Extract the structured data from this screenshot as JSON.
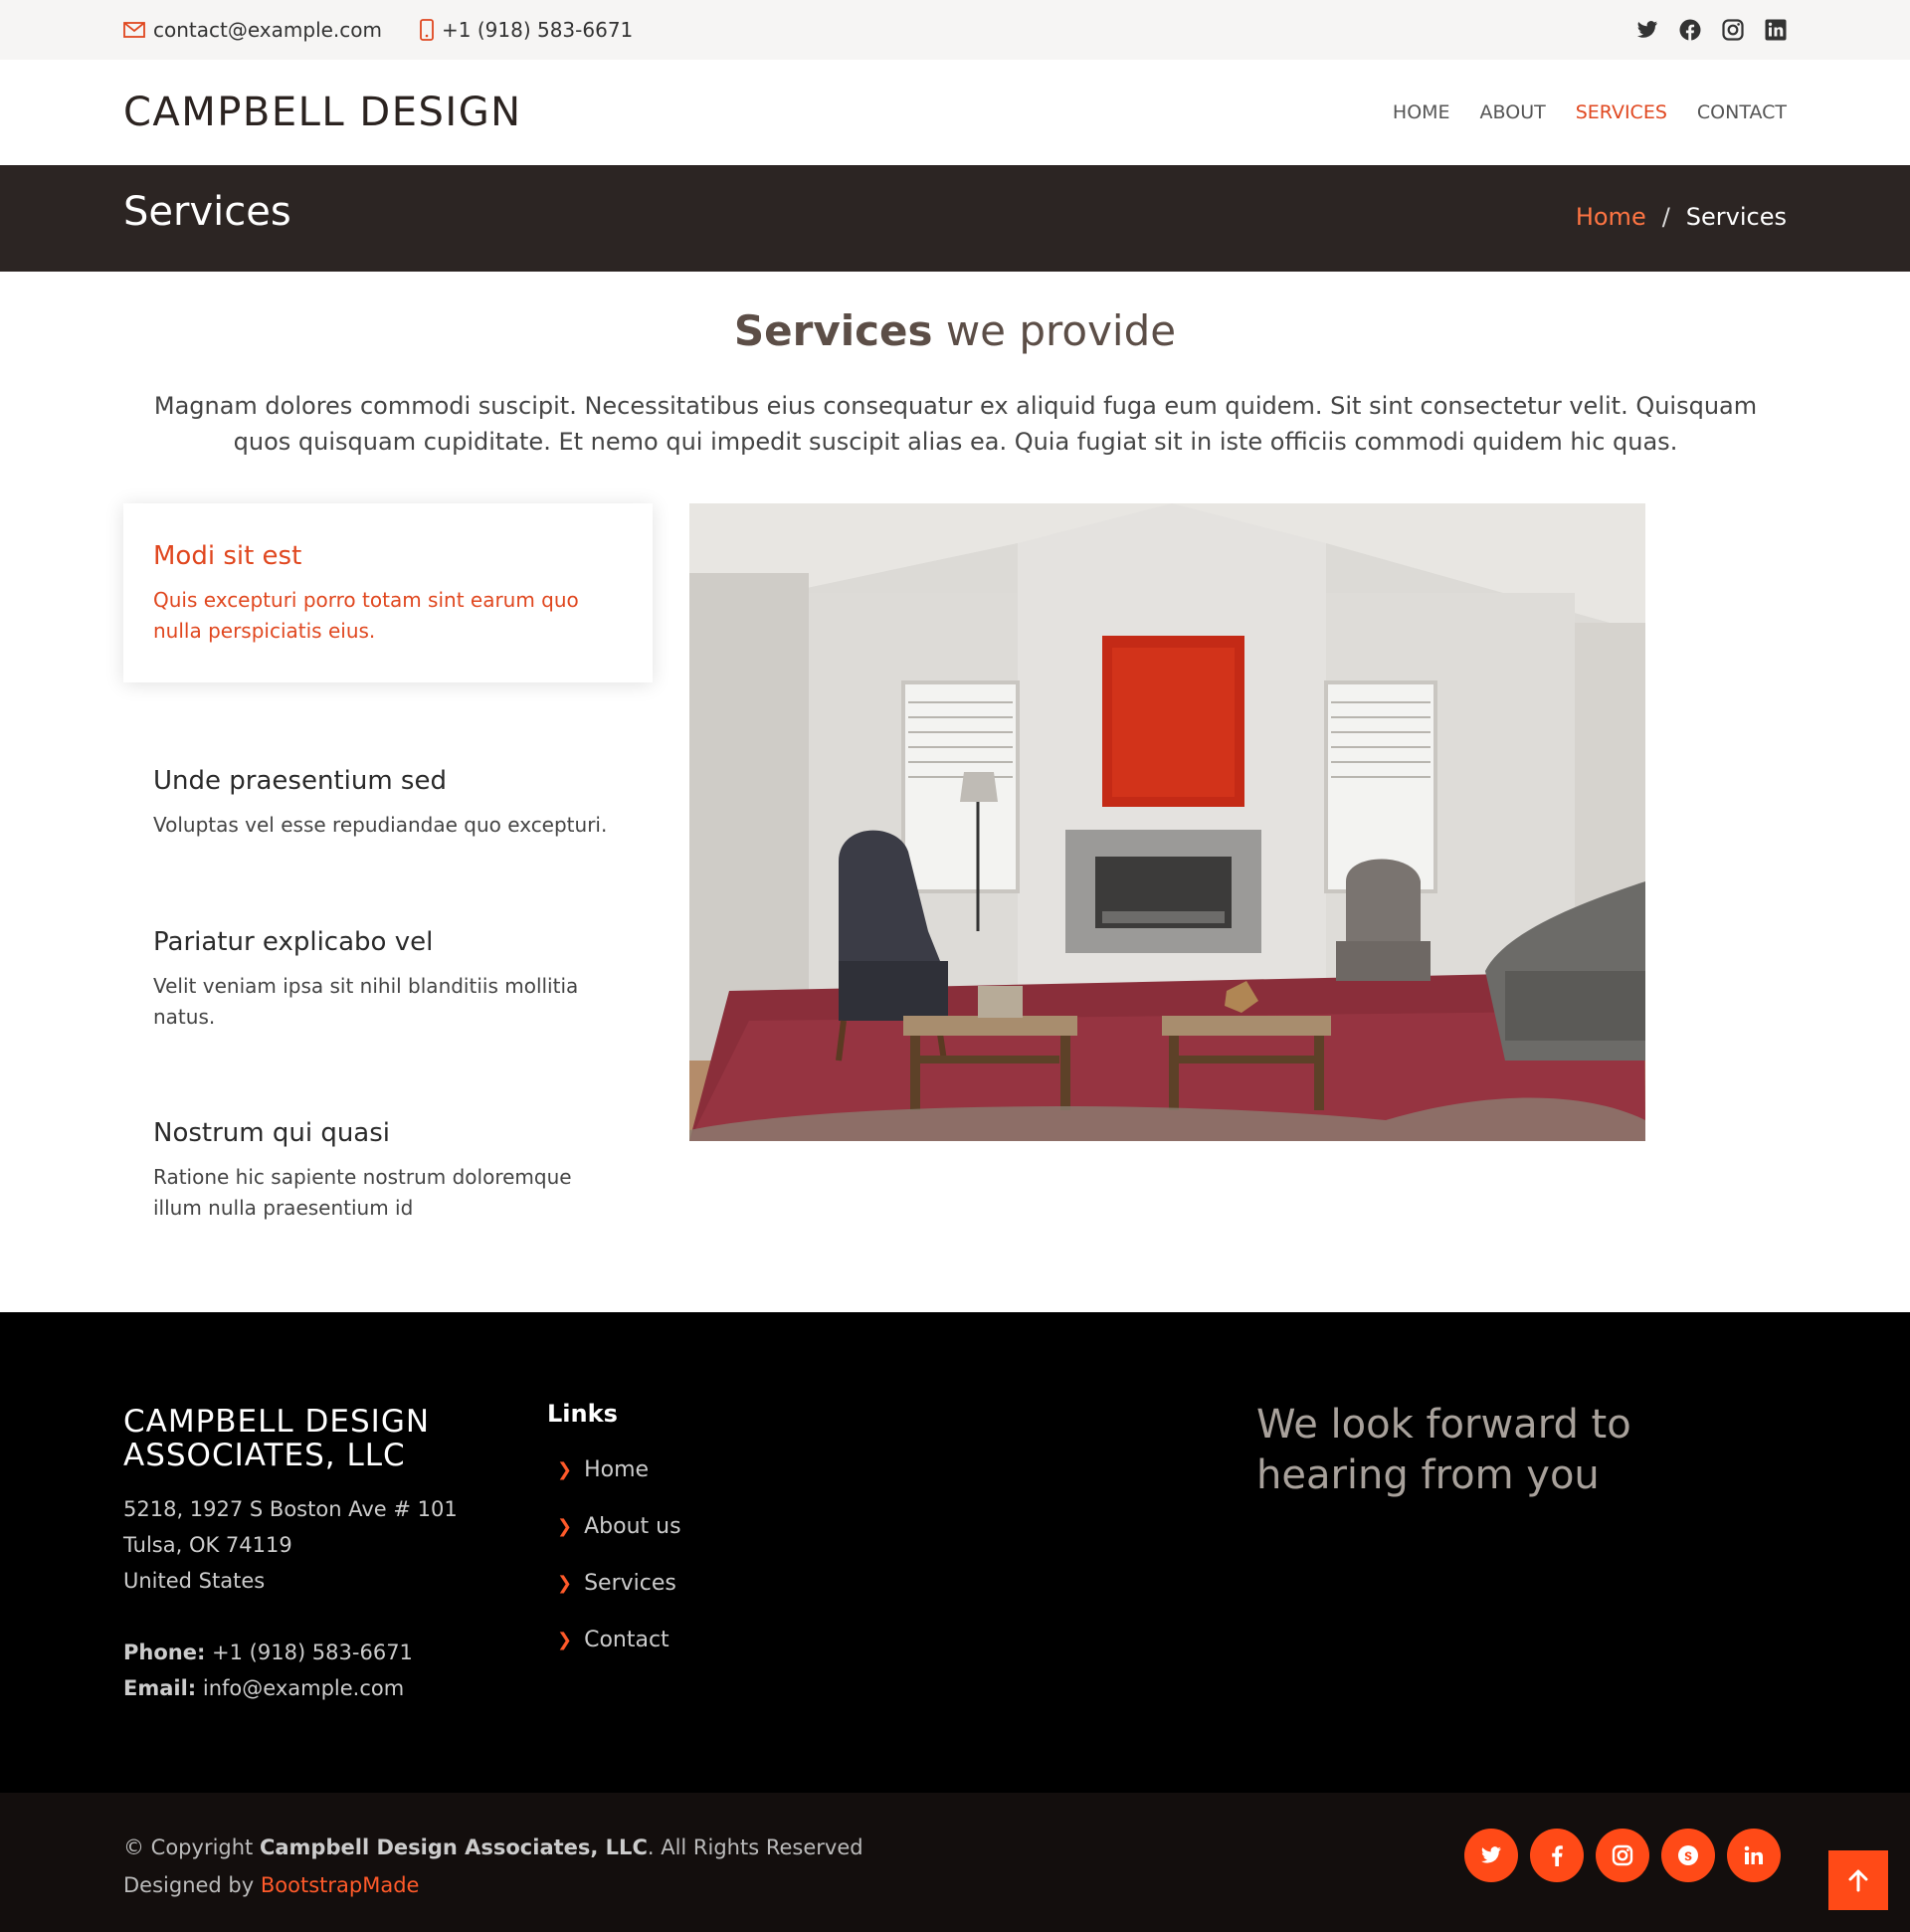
{
  "topbar": {
    "email": "contact@example.com",
    "phone": "+1 (918) 583-6671",
    "social_icons": [
      "twitter-icon",
      "facebook-icon",
      "instagram-icon",
      "linkedin-icon"
    ]
  },
  "header": {
    "logo": "CAMPBELL DESIGN",
    "nav": [
      {
        "label": "HOME",
        "active": false
      },
      {
        "label": "ABOUT",
        "active": false
      },
      {
        "label": "SERVICES",
        "active": true
      },
      {
        "label": "CONTACT",
        "active": false
      }
    ]
  },
  "breadcrumbs": {
    "title": "Services",
    "home": "Home",
    "separator": "/",
    "current": "Services"
  },
  "services": {
    "title_bold": "Services",
    "title_rest": " we provide",
    "description": "Magnam dolores commodi suscipit. Necessitatibus eius consequatur ex aliquid fuga eum quidem. Sit sint consectetur velit. Quisquam quos quisquam cupiditate. Et nemo qui impedit suscipit alias ea. Quia fugiat sit in iste officiis commodi quidem hic quas.",
    "tabs": [
      {
        "title": "Modi sit est",
        "text": "Quis excepturi porro totam sint earum quo nulla perspiciatis eius.",
        "active": true
      },
      {
        "title": "Unde praesentium sed",
        "text": "Voluptas vel esse repudiandae quo excepturi.",
        "active": false
      },
      {
        "title": "Pariatur explicabo vel",
        "text": "Velit veniam ipsa sit nihil blanditiis mollitia natus.",
        "active": false
      },
      {
        "title": "Nostrum qui quasi",
        "text": "Ratione hic sapiente nostrum doloremque illum nulla praesentium id",
        "active": false
      }
    ]
  },
  "footer": {
    "company": "CAMPBELL DESIGN ASSOCIATES, LLC",
    "address_line1": "5218, 1927 S Boston Ave # 101",
    "address_line2": "Tulsa, OK 74119",
    "address_line3": "United States",
    "phone_label": "Phone:",
    "phone": " +1 (918) 583-6671",
    "email_label": "Email:",
    "email": " info@example.com",
    "links_title": "Links",
    "links": [
      "Home",
      "About us",
      "Services",
      "Contact"
    ],
    "slogan": "We look forward to hearing from you"
  },
  "bottom": {
    "copyright_prefix": "© Copyright ",
    "copyright_name": "Campbell Design Associates, LLC",
    "copyright_suffix": ". All Rights Reserved",
    "designed_by": "Designed by ",
    "designer": "BootstrapMade",
    "social_icons": [
      "twitter-icon",
      "facebook-icon",
      "instagram-icon",
      "skype-icon",
      "linkedin-icon"
    ]
  },
  "colors": {
    "accent": "#e0471f",
    "accent_bright": "#ff4a17",
    "dark_band": "#2c2523",
    "footer_bg": "#000000",
    "bottom_bg": "#130e0d"
  }
}
